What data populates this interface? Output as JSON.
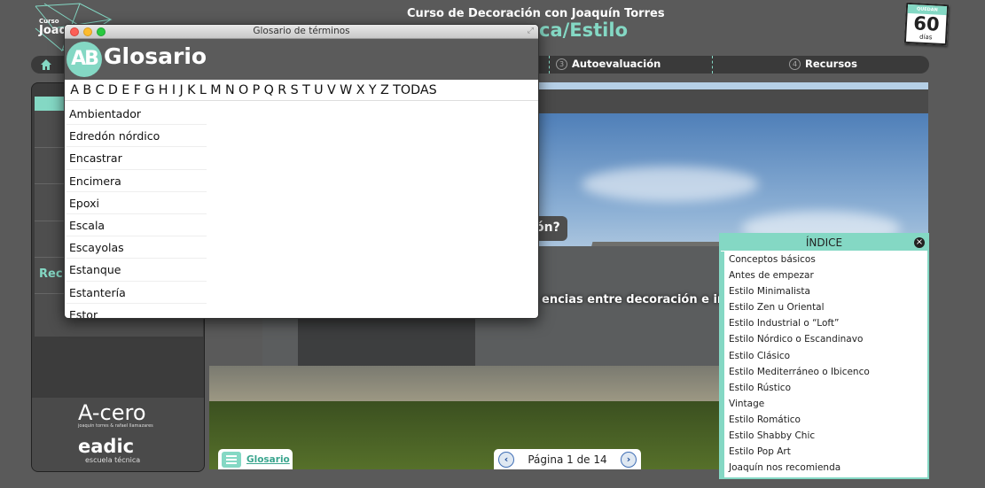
{
  "header": {
    "logo_small": "Curso",
    "logo_big": "Joaq",
    "course_title": "Curso de Decoración con Joaquín Torres",
    "section_title": "ca/Estilo",
    "days_label_top": "QUEDAN",
    "days_value": "60",
    "days_label_bottom": "días"
  },
  "nav": {
    "items": [
      {
        "num": "3",
        "label": "Autoevaluación"
      },
      {
        "num": "4",
        "label": "Recursos"
      }
    ]
  },
  "left_panel": {
    "partial_label": "Rec",
    "acero": "A-cero",
    "acero_sub": "joaquin torres & rafael llamazares",
    "eadic": "eadic",
    "eadic_sub": "escuela técnica"
  },
  "main": {
    "question_partial": "ón?",
    "banner_partial": "encias entre decoración e int",
    "glossary_tab": "Glosario",
    "pager_text": "Página 1 de 14"
  },
  "index": {
    "title": "ÍNDICE",
    "items": [
      "Conceptos básicos",
      "Antes de empezar",
      "Estilo Minimalista",
      "Estilo Zen u Oriental",
      "Estilo Industrial o “Loft”",
      "Estilo Nórdico o Escandinavo",
      "Estilo Clásico",
      "Estilo Mediterráneo o Ibicenco",
      "Estilo Rústico",
      "Vintage",
      "Estilo Romático",
      "Estilo Shabby Chic",
      "Estilo Pop Art",
      "Joaquín nos recomienda"
    ]
  },
  "glossary_window": {
    "window_title": "Glosario de términos",
    "badge": "AB",
    "title": "Glosario",
    "letters": [
      "A",
      "B",
      "C",
      "D",
      "E",
      "F",
      "G",
      "H",
      "I",
      "J",
      "K",
      "L",
      "M",
      "N",
      "O",
      "P",
      "Q",
      "R",
      "S",
      "T",
      "U",
      "V",
      "W",
      "X",
      "Y",
      "Z",
      "TODAS"
    ],
    "terms": [
      "Ambientador",
      "Edredón nórdico",
      "Encastrar",
      "Encimera",
      "Epoxi",
      "Escala",
      "Escayolas",
      "Estanque",
      "Estantería",
      "Estor"
    ]
  },
  "colors": {
    "accent": "#84d8c4",
    "background": "#5a5a5a"
  }
}
